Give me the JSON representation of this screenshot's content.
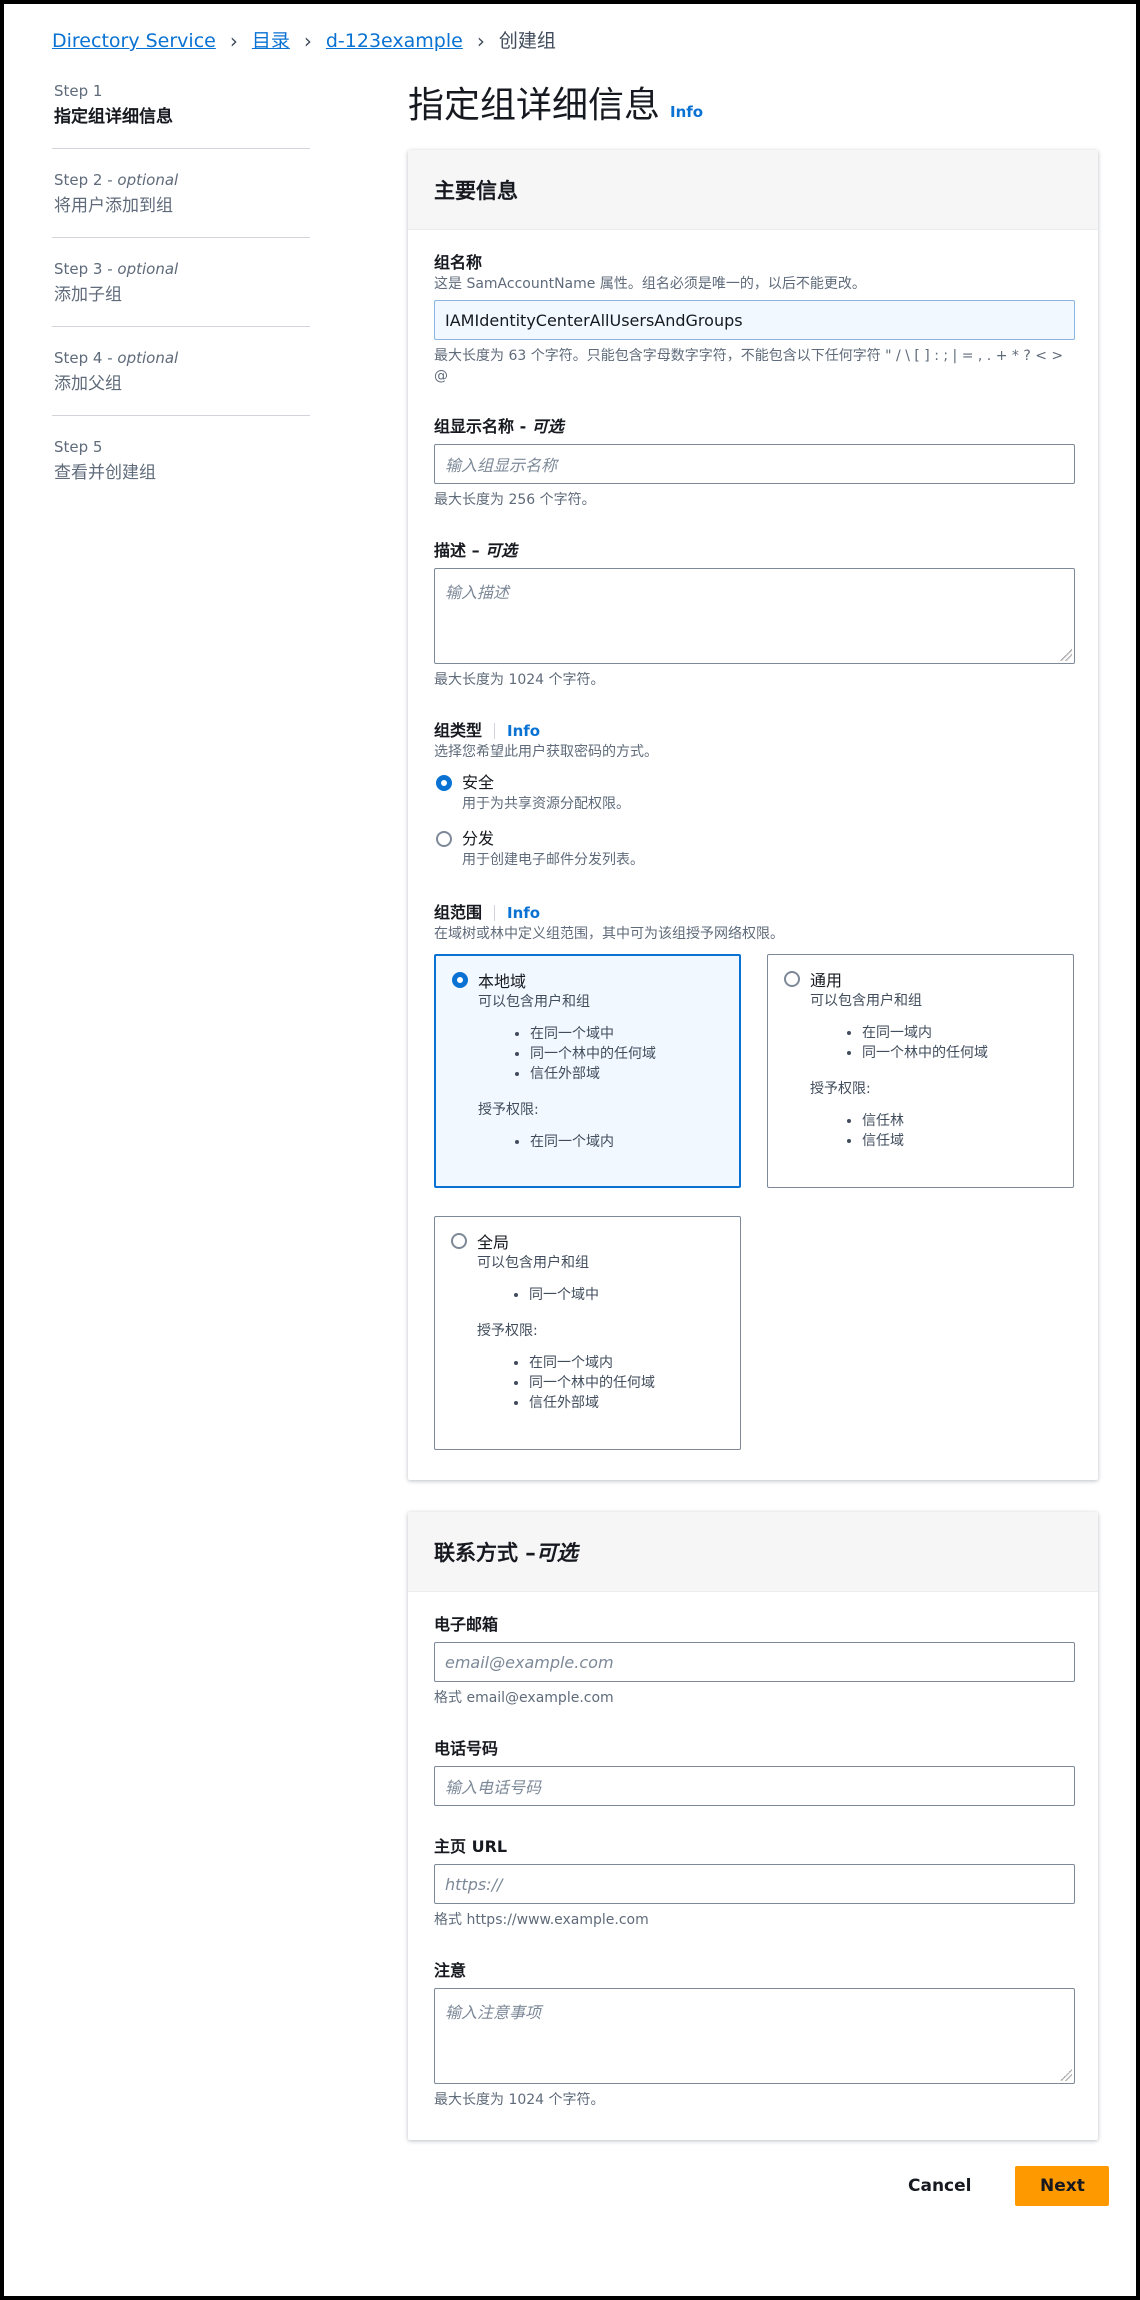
{
  "breadcrumb": {
    "items": [
      "Directory Service",
      "目录",
      "d-123example"
    ],
    "current": "创建组"
  },
  "steps": [
    {
      "label": "Step 1",
      "optional": "",
      "title": "指定组详细信息"
    },
    {
      "label": "Step 2 - ",
      "optional": "optional",
      "title": "将用户添加到组"
    },
    {
      "label": "Step 3 - ",
      "optional": "optional",
      "title": "添加子组"
    },
    {
      "label": "Step 4 - ",
      "optional": "optional",
      "title": "添加父组"
    },
    {
      "label": "Step 5",
      "optional": "",
      "title": "查看并创建组"
    }
  ],
  "page": {
    "title": "指定组详细信息",
    "info": "Info"
  },
  "main_panel": {
    "header": "主要信息",
    "group_name": {
      "label": "组名称",
      "desc": "这是 SamAccountName 属性。组名必须是唯一的，以后不能更改。",
      "value": "IAMIdentityCenterAllUsersAndGroups",
      "hint": "最大长度为 63 个字符。只能包含字母数字字符，不能包含以下任何字符 \" / \\ [ ] : ; | = , . + * ? < > @"
    },
    "display_name": {
      "label": "组显示名称 - ",
      "optional": "可选",
      "placeholder": "输入组显示名称",
      "hint": "最大长度为 256 个字符。"
    },
    "description": {
      "label": "描述 – ",
      "optional": "可选",
      "placeholder": "输入描述",
      "hint": "最大长度为 1024 个字符。"
    },
    "group_type": {
      "label": "组类型",
      "info": "Info",
      "desc": "选择您希望此用户获取密码的方式。",
      "options": [
        {
          "title": "安全",
          "desc": "用于为共享资源分配权限。",
          "checked": true
        },
        {
          "title": "分发",
          "desc": "用于创建电子邮件分发列表。",
          "checked": false
        }
      ]
    },
    "group_scope": {
      "label": "组范围",
      "info": "Info",
      "desc": "在域树或林中定义组范围，其中可为该组授予网络权限。",
      "tiles": [
        {
          "title": "本地域",
          "selected": true,
          "text": "可以包含用户和组",
          "members": [
            "在同一个域中",
            "同一个林中的任何域",
            "信任外部域"
          ],
          "grant_label": "授予权限:",
          "grants": [
            "在同一个域内"
          ]
        },
        {
          "title": "通用",
          "selected": false,
          "text": "可以包含用户和组",
          "members": [
            "在同一域内",
            "同一个林中的任何域"
          ],
          "grant_label": "授予权限:",
          "grants": [
            "信任林",
            "信任域"
          ]
        },
        {
          "title": "全局",
          "selected": false,
          "text": "可以包含用户和组",
          "members": [
            "同一个域中"
          ],
          "grant_label": "授予权限:",
          "grants": [
            "在同一个域内",
            "同一个林中的任何域",
            "信任外部域"
          ]
        }
      ]
    }
  },
  "contact_panel": {
    "header": "联系方式 – ",
    "header_optional": "可选",
    "email": {
      "label": "电子邮箱",
      "placeholder": "email@example.com",
      "hint": "格式 email@example.com"
    },
    "phone": {
      "label": "电话号码",
      "placeholder": "输入电话号码"
    },
    "homepage": {
      "label": "主页 URL",
      "placeholder": "https://",
      "hint": "格式 https://www.example.com"
    },
    "notes": {
      "label": "注意",
      "placeholder": "输入注意事项",
      "hint": "最大长度为 1024 个字符。"
    }
  },
  "footer": {
    "cancel": "Cancel",
    "next": "Next"
  },
  "colors": {
    "accent": "#0972d3",
    "primary_button": "#ff9900"
  }
}
